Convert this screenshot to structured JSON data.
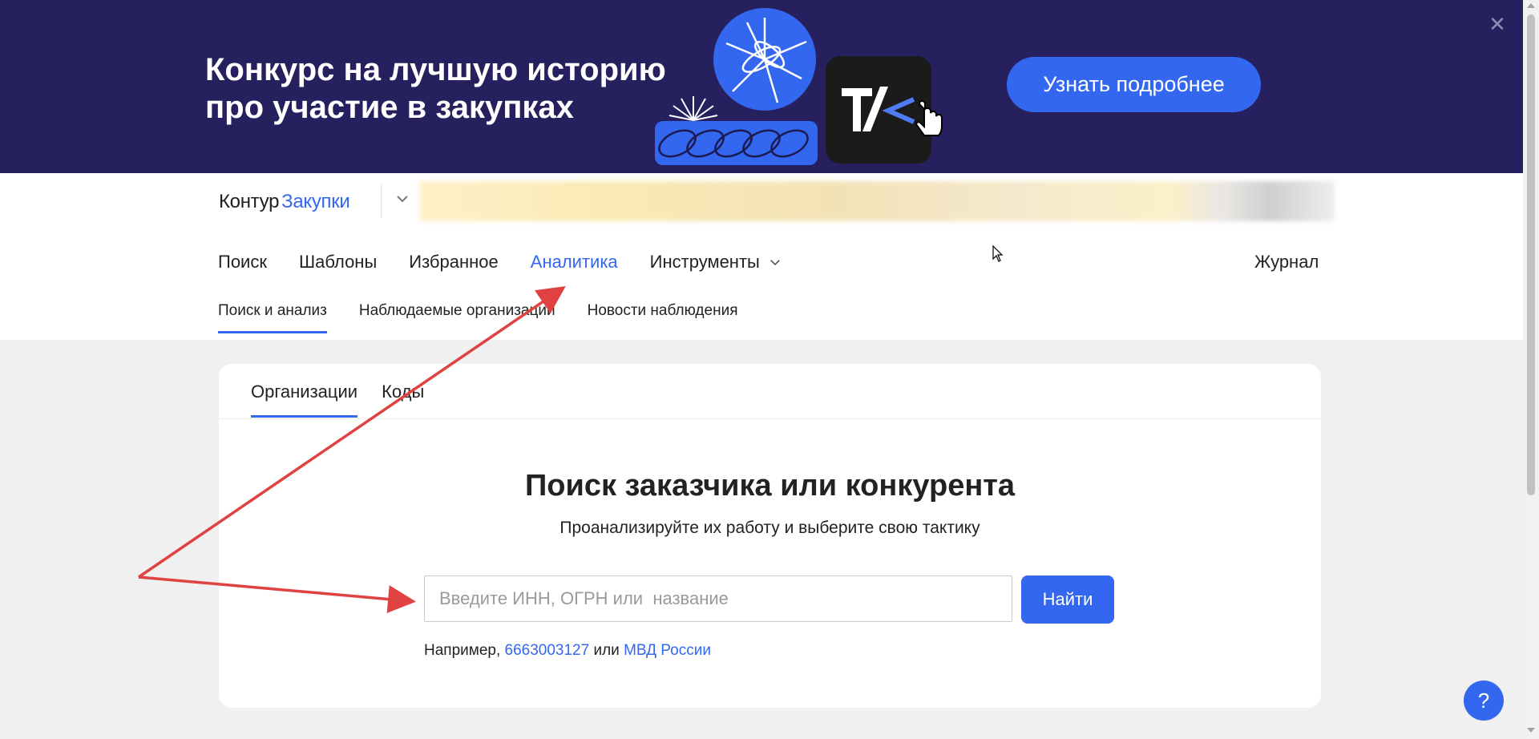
{
  "banner": {
    "title_line1": "Конкурс на лучшую историю",
    "title_line2": "про участие в закупках",
    "cta_label": "Узнать подробнее",
    "close_icon": "close-icon",
    "bg_color": "#26215e"
  },
  "header": {
    "logo_part1": "Контур",
    "logo_part2": "Закупки",
    "product_switch_icon": "chevron-down-icon"
  },
  "nav": {
    "items": [
      {
        "label": "Поиск",
        "active": false
      },
      {
        "label": "Шаблоны",
        "active": false
      },
      {
        "label": "Избранное",
        "active": false
      },
      {
        "label": "Аналитика",
        "active": true
      },
      {
        "label": "Инструменты",
        "active": false,
        "dropdown": true
      }
    ],
    "journal": "Журнал"
  },
  "subnav": {
    "items": [
      {
        "label": "Поиск и анализ",
        "active": true
      },
      {
        "label": "Наблюдаемые организации",
        "active": false
      },
      {
        "label": "Новости наблюдения",
        "active": false
      }
    ]
  },
  "search_card": {
    "tabs": [
      {
        "label": "Организации",
        "active": true
      },
      {
        "label": "Коды",
        "active": false
      }
    ],
    "title": "Поиск заказчика или конкурента",
    "subtitle": "Проанализируйте их работу и выберите свою тактику",
    "input_placeholder": "Введите ИНН, ОГРН или  название",
    "input_value": "",
    "button_label": "Найти",
    "example_prefix": "Например,",
    "example_link1": "6663003127",
    "example_between": "или",
    "example_link2": "МВД России"
  },
  "help": {
    "label": "?"
  },
  "colors": {
    "accent": "#3467ef",
    "annotation_arrow": "#e04141",
    "page_bg": "#f0f0f0"
  }
}
